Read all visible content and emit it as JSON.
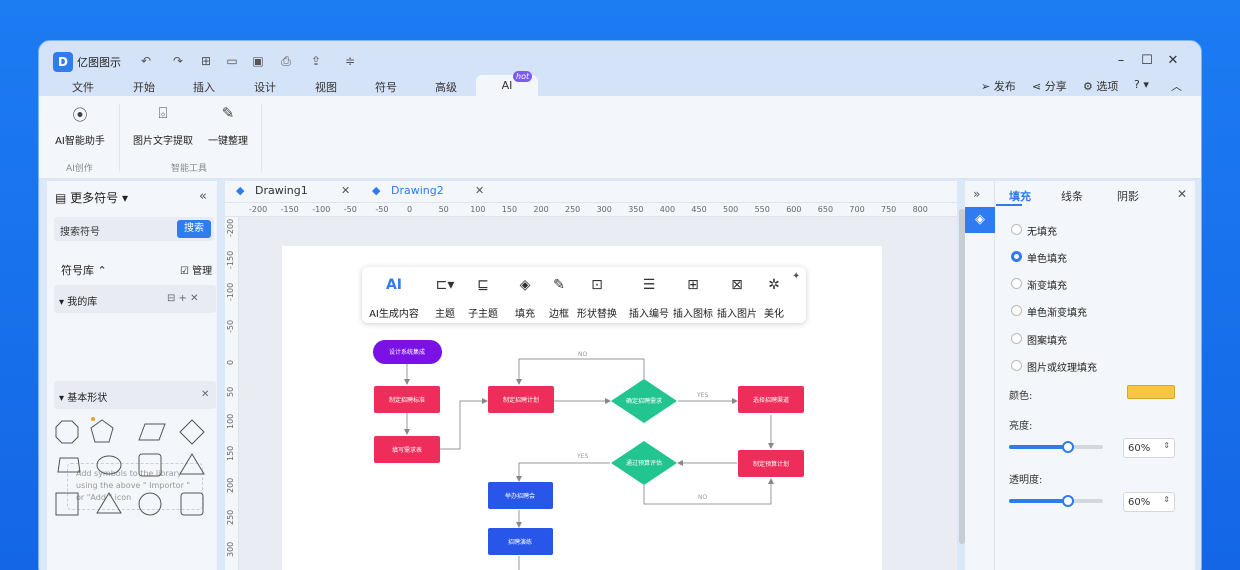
{
  "app": {
    "name": "亿图图示",
    "logo": "D"
  },
  "menu": [
    "文件",
    "开始",
    "插入",
    "设计",
    "视图",
    "符号",
    "高级",
    "AI"
  ],
  "hot": "hot",
  "right_tools": {
    "publish": "发布",
    "share": "分享",
    "options": "选项"
  },
  "ribbon": {
    "ai_assistant": "AI智能助手",
    "ocr": "图片文字提取",
    "tidy": "一键整理",
    "group1": "AI创作",
    "group2": "智能工具"
  },
  "left": {
    "title": "更多符号",
    "search_placeholder": "搜索符号",
    "search_btn": "搜索",
    "library": "符号库",
    "manage": "管理",
    "mylib": "我的库",
    "empty_text": "Add symbols to the library using the above \" Importor \" or \"Add \" icon",
    "basic": "基本形状"
  },
  "tabs": [
    "Drawing1",
    "Drawing2"
  ],
  "ruler_h": [
    "-200",
    "-150",
    "-100",
    "-50",
    "-50",
    "0",
    "50",
    "100",
    "150",
    "200",
    "250",
    "300",
    "350",
    "400",
    "450",
    "500",
    "550",
    "600",
    "650",
    "700",
    "750",
    "800"
  ],
  "ruler_v": [
    "-200",
    "-150",
    "-100",
    "-50",
    "0",
    "50",
    "100",
    "150",
    "200",
    "250",
    "300"
  ],
  "aitool": {
    "ai": "AI生成内容",
    "topic": "主题",
    "subtopic": "子主题",
    "fill": "填充",
    "border": "边框",
    "shape_swap": "形状替换",
    "numbering": "插入编号",
    "insert_icon": "插入图标",
    "insert_image": "插入图片",
    "beautify": "美化"
  },
  "flow": {
    "start": "设计系统集成",
    "n1": "制定招聘标准",
    "n2": "填写需求表",
    "n3": "制定招聘计划",
    "d1": "确定招聘需求",
    "n4": "选择招聘渠道",
    "d2": "通过预算评估",
    "n5": "制定预算计划",
    "n6": "举办招聘会",
    "n7": "招聘演练",
    "yes": "YES",
    "no": "NO"
  },
  "panel": {
    "tab_fill": "填充",
    "tab_line": "线条",
    "tab_shadow": "阴影",
    "options": [
      "无填充",
      "单色填充",
      "渐变填充",
      "单色渐变填充",
      "图案填充",
      "图片或纹理填充"
    ],
    "color_label": "颜色:",
    "brightness_label": "亮度:",
    "brightness": "60%",
    "transparency_label": "透明度:",
    "transparency": "60%",
    "color": "#f7c542"
  }
}
